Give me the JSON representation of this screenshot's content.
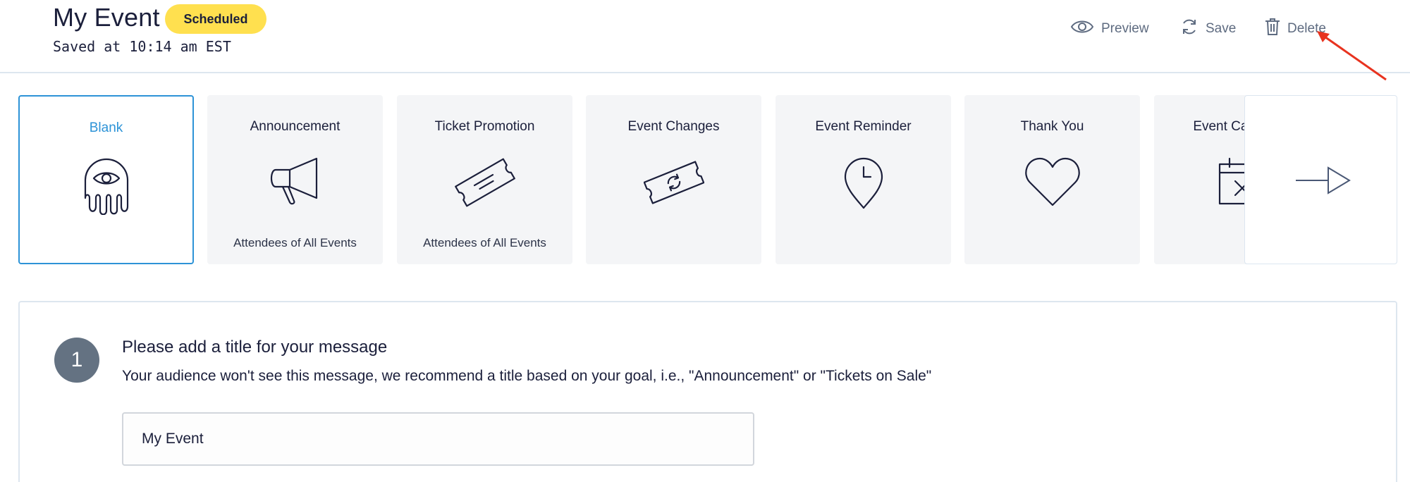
{
  "header": {
    "title": "My Event",
    "status_badge": "Scheduled",
    "saved_text": "Saved at 10:14 am EST",
    "actions": {
      "preview": {
        "label": "Preview",
        "icon": "eye-icon"
      },
      "save": {
        "label": "Save",
        "icon": "sync-icon"
      },
      "delete": {
        "label": "Delete",
        "icon": "trash-icon"
      }
    }
  },
  "templates": [
    {
      "title": "Blank",
      "icon": "ghost-icon",
      "subtitle": "",
      "selected": true
    },
    {
      "title": "Announcement",
      "icon": "megaphone-icon",
      "subtitle": "Attendees of All Events",
      "selected": false
    },
    {
      "title": "Ticket Promotion",
      "icon": "ticket-icon",
      "subtitle": "Attendees of All Events",
      "selected": false
    },
    {
      "title": "Event Changes",
      "icon": "ticket-refresh-icon",
      "subtitle": "",
      "selected": false
    },
    {
      "title": "Event Reminder",
      "icon": "map-pin-clock-icon",
      "subtitle": "",
      "selected": false
    },
    {
      "title": "Thank You",
      "icon": "heart-icon",
      "subtitle": "",
      "selected": false
    },
    {
      "title": "Event Cancelled",
      "icon": "calendar-x-icon",
      "subtitle": "",
      "selected": false
    }
  ],
  "next_button": {
    "icon": "arrow-right-icon"
  },
  "step": {
    "number": "1",
    "title": "Please add a title for your message",
    "description": "Your audience won't see this message, we recommend a title based on your goal, i.e., \"Announcement\" or \"Tickets on Sale\"",
    "input_value": "My Event"
  },
  "colors": {
    "accent": "#2d93d7",
    "badge": "#ffe04f",
    "step_circle": "#647282",
    "annotation_arrow": "#e8331f"
  }
}
